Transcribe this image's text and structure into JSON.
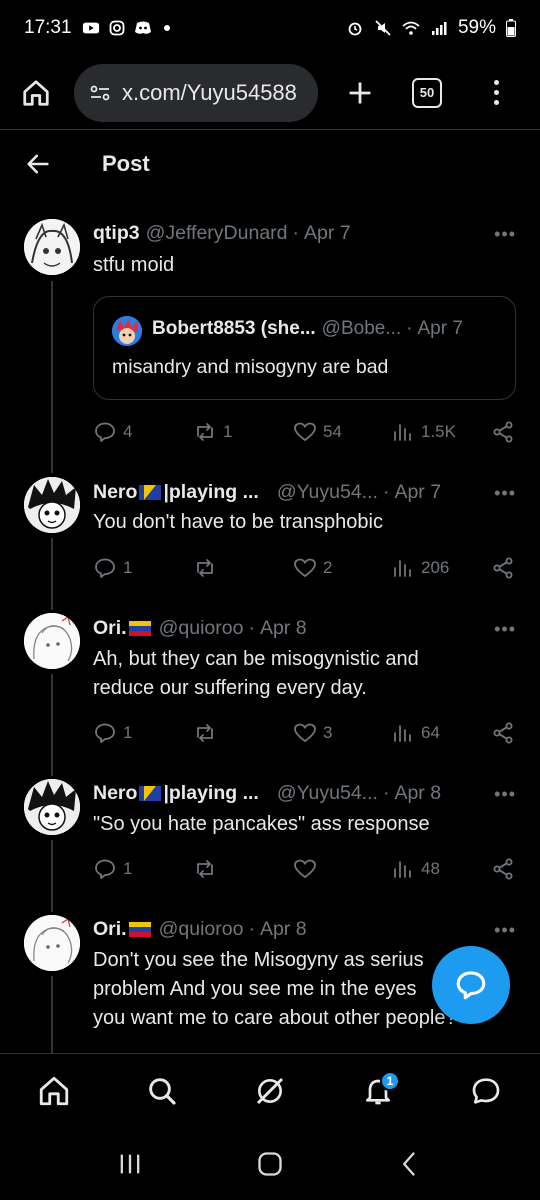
{
  "status_bar": {
    "time": "17:31",
    "battery": "59%"
  },
  "browser": {
    "url": "x.com/Yuyu54588",
    "tab_count": "50"
  },
  "header": {
    "title": "Post"
  },
  "tweets": [
    {
      "name": "qtip3",
      "handle": "@JefferyDunard",
      "date": "Apr 7",
      "text": "stfu moid",
      "quote": {
        "name": "Bobert8853 (she...",
        "handle": "@Bobe...",
        "date": "Apr 7",
        "text": "misandry and misogyny are bad"
      },
      "replies": "4",
      "reposts": "1",
      "likes": "54",
      "views": "1.5K"
    },
    {
      "name": "Nero",
      "name_suffix": "|playing ...",
      "handle": "@Yuyu54...",
      "date": "Apr 7",
      "text": "You don't have to be transphobic",
      "replies": "1",
      "reposts": "",
      "likes": "2",
      "views": "206"
    },
    {
      "name": "Ori.",
      "handle": "@quioroo",
      "date": "Apr 8",
      "text_line1": "Ah, but they can be misogynistic and",
      "text_line2": "reduce our suffering every day.",
      "replies": "1",
      "reposts": "",
      "likes": "3",
      "views": "64"
    },
    {
      "name": "Nero",
      "name_suffix": "|playing ...",
      "handle": "@Yuyu54...",
      "date": "Apr 8",
      "text": "\"So you hate pancakes\" ass response",
      "replies": "1",
      "reposts": "",
      "likes": "",
      "views": "48"
    },
    {
      "name": "Ori.",
      "handle": "@quioroo",
      "date": "Apr 8",
      "text_line1": "Don't you see the Misogyny as serius",
      "text_line2": "problem And you see me in the eyes",
      "text_line3": "you want me to care about other people?"
    }
  ],
  "bottom_nav": {
    "notifications_badge": "1"
  },
  "colors": {
    "accent": "#1d9bf0",
    "background": "#000000",
    "muted": "#71767b"
  }
}
